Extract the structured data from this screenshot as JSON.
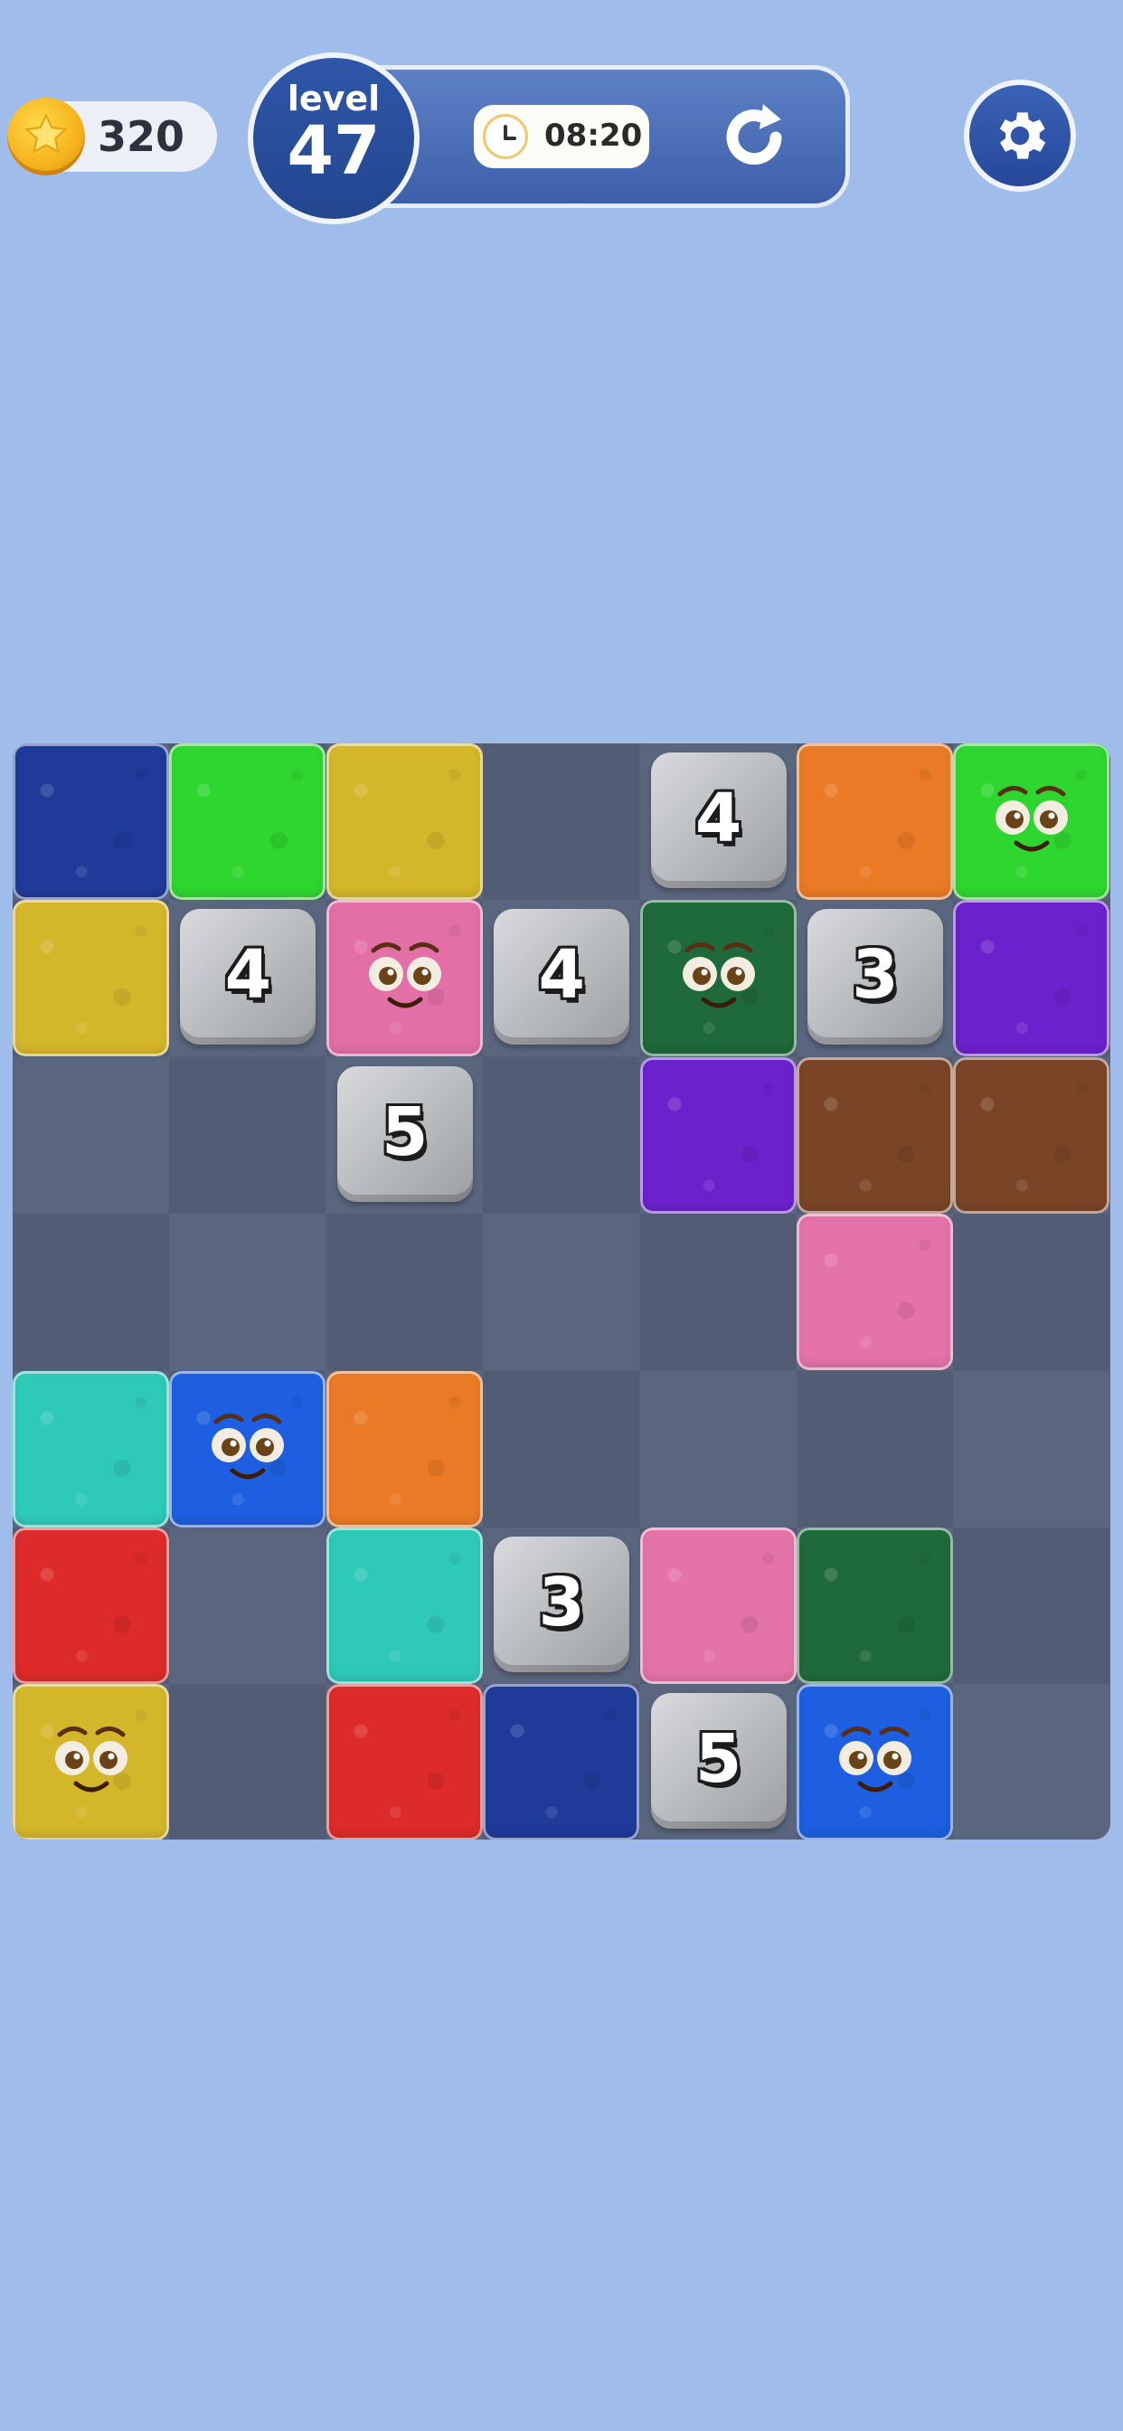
{
  "hud": {
    "coins": "320",
    "level_label": "level",
    "level_number": "47",
    "timer": "08:20",
    "icons": [
      "star-coin-icon",
      "clock-icon",
      "restart-icon",
      "gear-icon"
    ]
  },
  "board": {
    "columns": 7,
    "rows": 7,
    "tiles": [
      {
        "col": 0,
        "row": 0,
        "color": "#1f3a99"
      },
      {
        "col": 1,
        "row": 0,
        "color": "#2fd62f"
      },
      {
        "col": 2,
        "row": 0,
        "color": "#d4b62a"
      },
      {
        "col": 5,
        "row": 0,
        "color": "#ea7a25"
      },
      {
        "col": 6,
        "row": 0,
        "color": "#2fd62f",
        "face": true
      },
      {
        "col": 0,
        "row": 1,
        "color": "#d4b62a"
      },
      {
        "col": 2,
        "row": 1,
        "color": "#e26fa6",
        "face": true
      },
      {
        "col": 4,
        "row": 1,
        "color": "#1f6a3a",
        "face": true
      },
      {
        "col": 6,
        "row": 1,
        "color": "#6b22cc"
      },
      {
        "col": 4,
        "row": 2,
        "color": "#6b22cc"
      },
      {
        "col": 5,
        "row": 2,
        "color": "#7a4526"
      },
      {
        "col": 6,
        "row": 2,
        "color": "#7a4526"
      },
      {
        "col": 5,
        "row": 3,
        "color": "#e373a8"
      },
      {
        "col": 0,
        "row": 4,
        "color": "#2fc9b8"
      },
      {
        "col": 1,
        "row": 4,
        "color": "#1d5fe0",
        "face": true
      },
      {
        "col": 2,
        "row": 4,
        "color": "#ea7a25"
      },
      {
        "col": 0,
        "row": 5,
        "color": "#dd2a2a"
      },
      {
        "col": 2,
        "row": 5,
        "color": "#2fc9b8"
      },
      {
        "col": 4,
        "row": 5,
        "color": "#e373a8"
      },
      {
        "col": 5,
        "row": 5,
        "color": "#1f6a3a"
      },
      {
        "col": 0,
        "row": 6,
        "color": "#d4b62a",
        "face": true
      },
      {
        "col": 2,
        "row": 6,
        "color": "#dd2a2a"
      },
      {
        "col": 3,
        "row": 6,
        "color": "#1f3a99"
      },
      {
        "col": 5,
        "row": 6,
        "color": "#1d5fe0",
        "face": true
      }
    ],
    "stones": [
      {
        "col": 4,
        "row": 0,
        "label": "4"
      },
      {
        "col": 1,
        "row": 1,
        "label": "4"
      },
      {
        "col": 3,
        "row": 1,
        "label": "4"
      },
      {
        "col": 5,
        "row": 1,
        "label": "3"
      },
      {
        "col": 2,
        "row": 2,
        "label": "5"
      },
      {
        "col": 3,
        "row": 5,
        "label": "3"
      },
      {
        "col": 4,
        "row": 6,
        "label": "5"
      }
    ]
  }
}
